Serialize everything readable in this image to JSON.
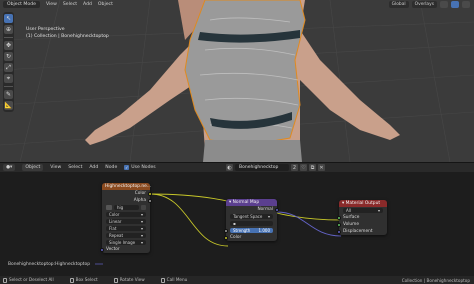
{
  "viewport": {
    "header": {
      "mode": "Object Mode",
      "menus": [
        "View",
        "Select",
        "Add",
        "Object"
      ],
      "transform": "Global",
      "overlays": "Overlays"
    },
    "info": {
      "perspective": "User Perspective",
      "collection": "(1) Collection | Bonehighnecktoptop"
    },
    "tools": [
      "cursor-tool",
      "move-tool",
      "rotate-tool",
      "scale-tool",
      "transform-tool",
      "annotate-tool",
      "measure-tool"
    ]
  },
  "node_editor": {
    "header": {
      "editor_mode": "Object",
      "menus": [
        "View",
        "Select",
        "Add",
        "Node"
      ],
      "use_nodes_label": "Use Nodes",
      "use_nodes_checked": true,
      "material_name": "Bonehighnecktop",
      "slot_count": "2"
    },
    "image_node": {
      "title": "Highnecktoptop.ne...",
      "outputs": [
        "Color",
        "Alpha"
      ],
      "image_name": "hig",
      "color_space": "Color",
      "interpolation": "Linear",
      "projection": "Flat",
      "extension": "Repeat",
      "source": "Single Image",
      "input": "Vector"
    },
    "normal_node": {
      "title": "Normal Map",
      "output": "Normal",
      "space": "Tangent Space",
      "uv_placeholder": "",
      "strength_label": "Strength",
      "strength_value": "1.000",
      "input": "Color"
    },
    "output_node": {
      "title": "Material Output",
      "target": "All",
      "inputs": [
        "Surface",
        "Volume",
        "Displacement"
      ]
    },
    "image_path_label": "Bonehighnecktoptop:Highnecktoptop"
  },
  "statusbar": {
    "items": [
      "Select or Deselect All",
      "Box Select",
      "Rotate View",
      "Call Menu"
    ],
    "right_text": "Collection | Bonehighnecktoptop"
  },
  "colors": {
    "image_node_header": "#8a4a1f",
    "normal_node_header": "#5b3f8f",
    "output_node_header": "#8a2a2a",
    "color_socket": "#c7c729",
    "vector_socket": "#6363c7",
    "shader_socket": "#63c763",
    "float_socket": "#a1a1a1",
    "accent_blue": "#4772b3"
  }
}
